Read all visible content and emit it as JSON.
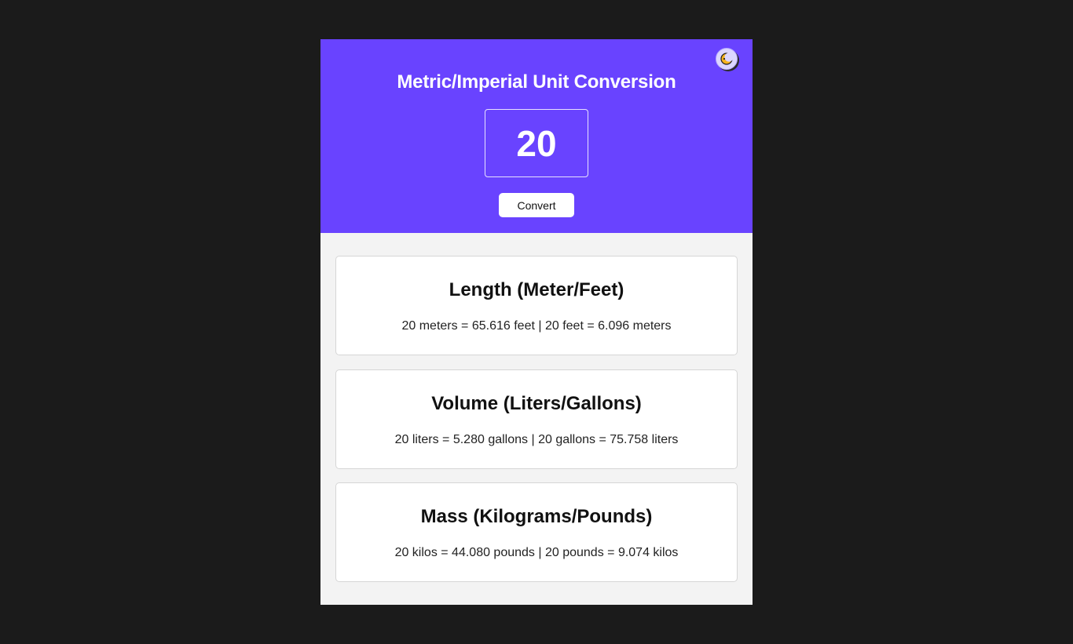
{
  "app": {
    "title": "Metric/Imperial Unit Conversion",
    "input_value": "20",
    "convert_label": "Convert",
    "theme_toggle_icon": "moon-icon"
  },
  "colors": {
    "page_background": "#1b1b1b",
    "hero_background": "#6943ff",
    "content_background": "#f3f3f3",
    "card_background": "#ffffff"
  },
  "cards": [
    {
      "title": "Length (Meter/Feet)",
      "result": "20 meters = 65.616 feet | 20 feet = 6.096 meters"
    },
    {
      "title": "Volume (Liters/Gallons)",
      "result": "20 liters = 5.280 gallons | 20 gallons = 75.758 liters"
    },
    {
      "title": "Mass (Kilograms/Pounds)",
      "result": "20 kilos = 44.080 pounds | 20 pounds = 9.074 kilos"
    }
  ]
}
